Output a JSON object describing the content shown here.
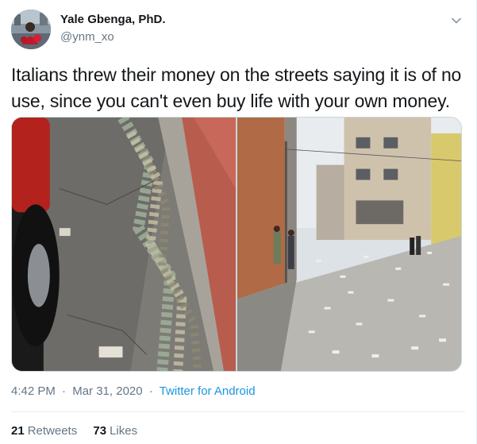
{
  "author": {
    "name": "Yale Gbenga, PhD.",
    "handle": "@ynm_xo",
    "avatar_icon": "profile-photo"
  },
  "tweet": {
    "text": "Italians threw their money on the streets saying it is of no use, since you can't even buy life with your own money."
  },
  "media": {
    "photos": [
      {
        "icon": "photo-money-by-curb"
      },
      {
        "icon": "photo-money-on-street"
      }
    ]
  },
  "meta": {
    "time": "4:42 PM",
    "separator": "·",
    "date": "Mar 31, 2020",
    "source": "Twitter for Android"
  },
  "stats": {
    "retweets_count": "21",
    "retweets_label": "Retweets",
    "likes_count": "73",
    "likes_label": "Likes"
  },
  "colors": {
    "link": "#1b95e0",
    "secondary_text": "#657786",
    "primary_text": "#14171a",
    "border": "#e6ecf0"
  }
}
